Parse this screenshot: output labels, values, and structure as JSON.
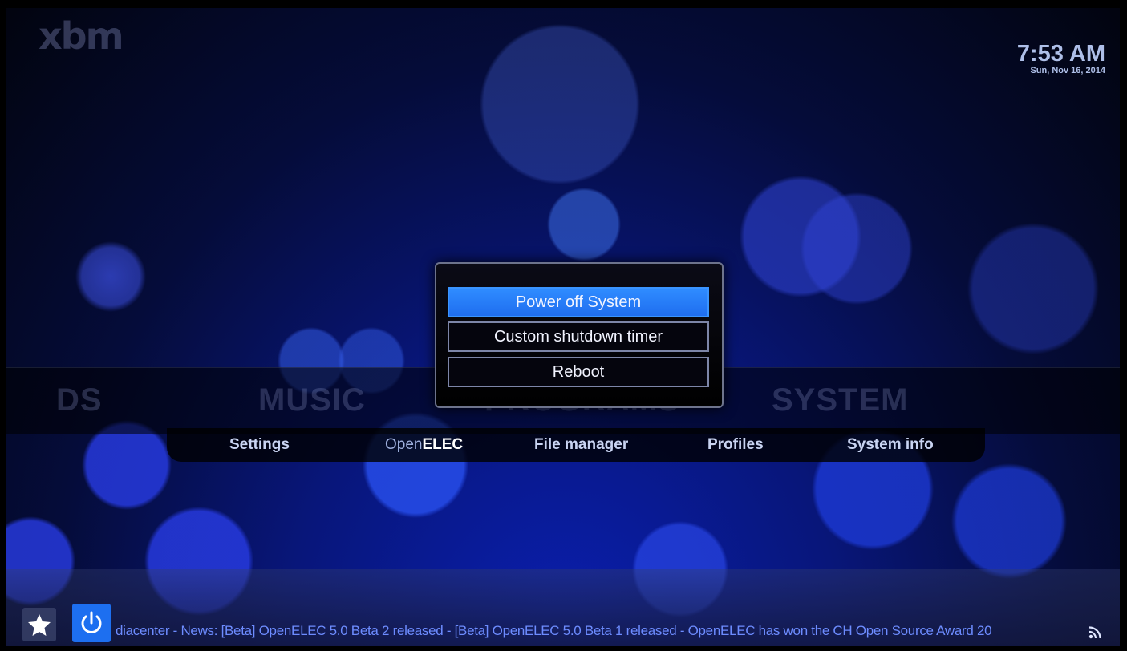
{
  "brand": {
    "logo_text": "xbm"
  },
  "clock": {
    "time": "7:53 AM",
    "date": "Sun, Nov 16, 2014"
  },
  "home_menu": {
    "categories": [
      "DS",
      "MUSIC",
      "PROGRAMS",
      "SYSTEM"
    ],
    "submenu": [
      {
        "label": "Settings"
      },
      {
        "label_prefix": "Open",
        "label_strong": "ELEC"
      },
      {
        "label": "File manager"
      },
      {
        "label": "Profiles"
      },
      {
        "label": "System info"
      }
    ]
  },
  "shutdown_dialog": {
    "options": [
      "Power off System",
      "Custom shutdown timer",
      "Reboot"
    ],
    "selected_index": 0
  },
  "ticker": {
    "text": "diacenter - News: [Beta] OpenELEC 5.0 Beta 2 released - [Beta] OpenELEC 5.0 Beta 1 released - OpenELEC has won the CH Open Source Award 20"
  },
  "icons": {
    "favourites": "star-icon",
    "power": "power-icon",
    "rss": "rss-icon"
  },
  "colors": {
    "accent": "#1d6ff0",
    "selected_option": "#2f8cff",
    "ticker_text": "#6d8cff"
  }
}
